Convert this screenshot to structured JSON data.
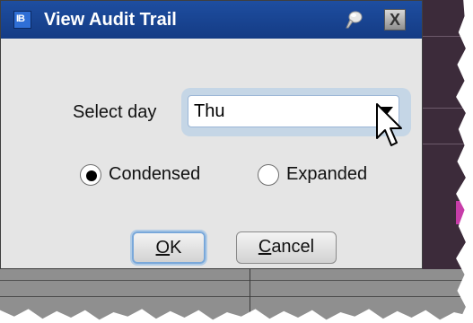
{
  "window": {
    "title": "View Audit Trail",
    "app_icon_text": "IB",
    "pin_icon": "pin-icon",
    "close_label": "X"
  },
  "form": {
    "select_day_label": "Select day",
    "select_day_value": "Thu",
    "radio_options": [
      {
        "label": "Condensed",
        "selected": true
      },
      {
        "label": "Expanded",
        "selected": false
      }
    ]
  },
  "buttons": {
    "ok_mnemonic": "O",
    "ok_rest": "K",
    "cancel_mnemonic": "C",
    "cancel_rest": "ancel"
  },
  "colors": {
    "titlebar": "#1e4ea0",
    "dialog_bg": "#e5e5e5",
    "focus_ring": "#79a8da"
  }
}
